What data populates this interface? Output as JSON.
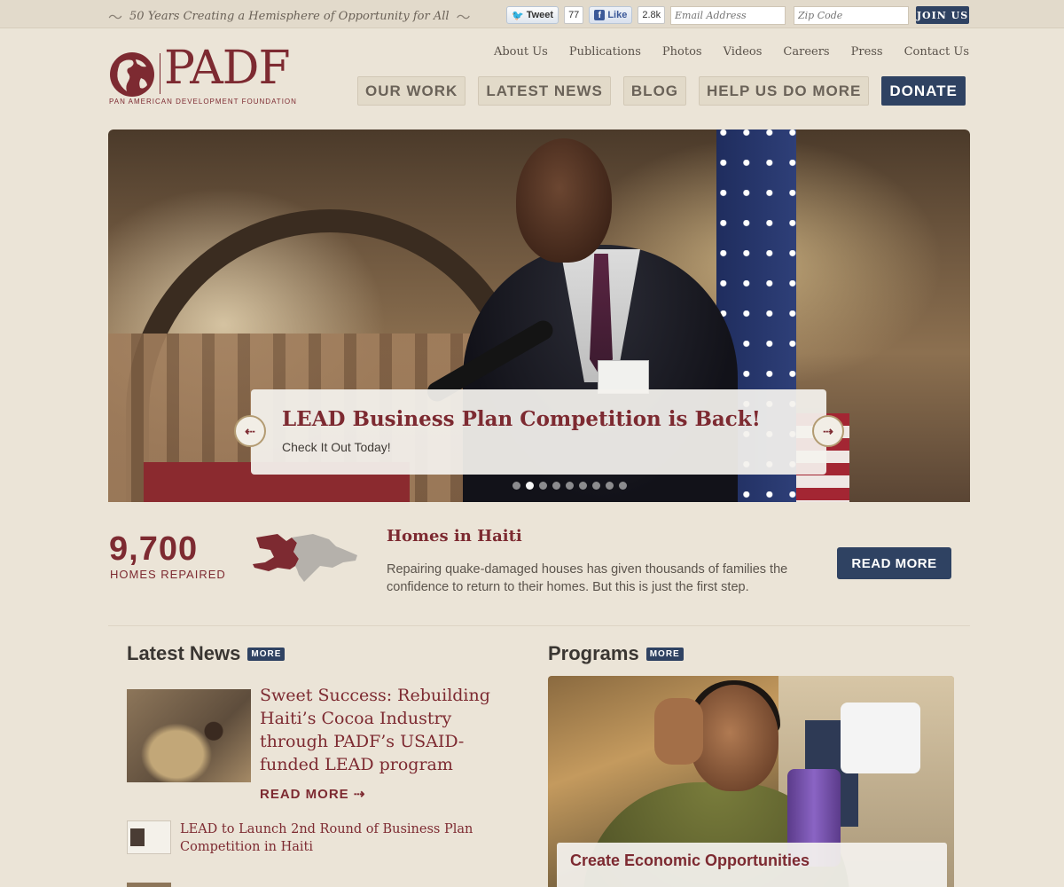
{
  "topbar": {
    "tagline": "50 Years Creating a Hemisphere of Opportunity for All",
    "tweet_label": "Tweet",
    "tweet_count": "77",
    "like_label": "Like",
    "like_count": "2.8k",
    "email_placeholder": "Email Address",
    "zip_placeholder": "Zip Code",
    "join_label": "JOIN US"
  },
  "logo": {
    "name": "PADF",
    "subtitle": "PAN AMERICAN DEVELOPMENT FOUNDATION"
  },
  "utility_nav": [
    "About Us",
    "Publications",
    "Photos",
    "Videos",
    "Careers",
    "Press",
    "Contact Us"
  ],
  "main_nav": {
    "our_work": "OUR WORK",
    "latest_news": "LATEST NEWS",
    "blog": "BLOG",
    "help": "HELP US DO MORE",
    "donate": "DONATE"
  },
  "hero": {
    "title": "LEAD Business Plan Competition is Back!",
    "subtitle": "Check It Out Today!",
    "prev_icon": "arrow-left-icon",
    "next_icon": "arrow-right-icon",
    "slide_count": 9,
    "active_slide": 2
  },
  "stat": {
    "number": "9,700",
    "label": "HOMES REPAIRED",
    "title": "Homes in Haiti",
    "description": "Repairing quake-damaged houses has given thousands of families the confidence to return to their homes. But this is just the first step.",
    "button": "READ MORE"
  },
  "news": {
    "heading": "Latest News",
    "more": "MORE",
    "items": [
      {
        "title": "Sweet Success: Rebuilding Haiti’s Cocoa Industry through PADF’s USAID-funded LEAD program",
        "more": "READ MORE ⇢"
      },
      {
        "title": "LEAD to Launch 2nd Round of Business Plan Competition in Haiti"
      }
    ]
  },
  "programs": {
    "heading": "Programs",
    "more": "MORE",
    "caption": "Create Economic Opportunities"
  },
  "colors": {
    "brand_red": "#7d2a31",
    "navy": "#2f4262",
    "background": "#ebe4d7"
  }
}
